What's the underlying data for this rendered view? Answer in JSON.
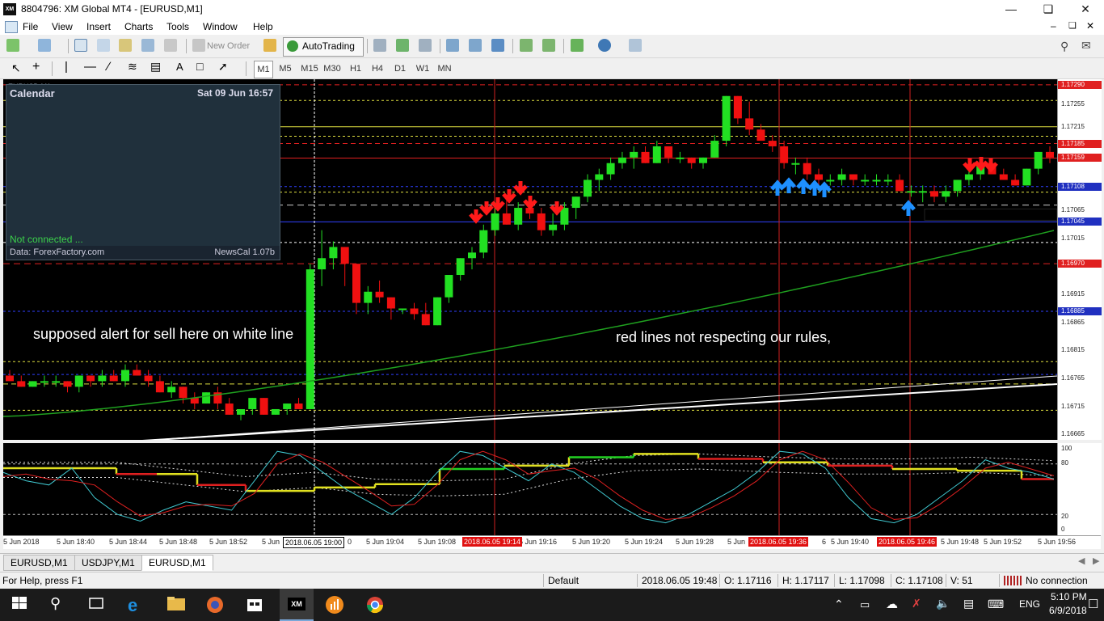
{
  "window": {
    "title": "8804796: XM Global MT4 - [EURUSD,M1]",
    "app_icon_text": "XM"
  },
  "menu": [
    "File",
    "View",
    "Insert",
    "Charts",
    "Tools",
    "Window",
    "Help"
  ],
  "toolbar": {
    "new_order": "New Order",
    "autotrading": "AutoTrading"
  },
  "timeframes": [
    "M1",
    "M5",
    "M15",
    "M30",
    "H1",
    "H4",
    "D1",
    "W1",
    "MN"
  ],
  "chart": {
    "symbol_label": "EURUSD,M1",
    "price_labels": [
      "1.17255",
      "1.17215",
      "1.17065",
      "1.17015",
      "1.16915",
      "1.16865",
      "1.16815",
      "1.16765",
      "1.16715",
      "1.16665"
    ],
    "price_boxes": [
      {
        "text": "1.17290",
        "color": "#e02020"
      },
      {
        "text": "1.17185",
        "color": "#e02020"
      },
      {
        "text": "1.17159",
        "color": "#e02020"
      },
      {
        "text": "1.17108",
        "color": "#2030c0"
      },
      {
        "text": "1.17045",
        "color": "#2030c0"
      },
      {
        "text": "1.16970",
        "color": "#e02020"
      },
      {
        "text": "1.16885",
        "color": "#2030c0"
      }
    ],
    "annotation_left": "supposed alert for sell here on white line",
    "annotation_right": "red lines not respecting our rules,",
    "candles": [
      [
        1.1677,
        1.1678,
        1.1676,
        1.1676
      ],
      [
        1.1676,
        1.1677,
        1.1675,
        1.1675
      ],
      [
        1.1675,
        1.1676,
        1.1675,
        1.1676
      ],
      [
        1.1676,
        1.1677,
        1.1675,
        1.1676
      ],
      [
        1.1676,
        1.1677,
        1.1675,
        1.1676
      ],
      [
        1.1676,
        1.1676,
        1.1674,
        1.1675
      ],
      [
        1.1675,
        1.1677,
        1.1674,
        1.1677
      ],
      [
        1.1677,
        1.1677,
        1.1675,
        1.1676
      ],
      [
        1.1676,
        1.1678,
        1.1675,
        1.1677
      ],
      [
        1.1677,
        1.1678,
        1.1676,
        1.1676
      ],
      [
        1.1676,
        1.1679,
        1.1675,
        1.1678
      ],
      [
        1.1678,
        1.1679,
        1.1677,
        1.1677
      ],
      [
        1.1677,
        1.1678,
        1.1675,
        1.1676
      ],
      [
        1.1676,
        1.1677,
        1.1674,
        1.1674
      ],
      [
        1.1674,
        1.1676,
        1.1673,
        1.1675
      ],
      [
        1.1675,
        1.1675,
        1.1672,
        1.1673
      ],
      [
        1.1673,
        1.1674,
        1.1671,
        1.1672
      ],
      [
        1.1672,
        1.1674,
        1.1672,
        1.1674
      ],
      [
        1.1674,
        1.1675,
        1.1671,
        1.1672
      ],
      [
        1.1672,
        1.1673,
        1.167,
        1.167
      ],
      [
        1.167,
        1.1671,
        1.1669,
        1.1671
      ],
      [
        1.1671,
        1.1673,
        1.167,
        1.1673
      ],
      [
        1.1673,
        1.1673,
        1.167,
        1.167
      ],
      [
        1.167,
        1.1671,
        1.167,
        1.1671
      ],
      [
        1.1671,
        1.1672,
        1.167,
        1.1672
      ],
      [
        1.1672,
        1.1673,
        1.1671,
        1.1671
      ],
      [
        1.1671,
        1.1697,
        1.1671,
        1.1696
      ],
      [
        1.1696,
        1.1703,
        1.1693,
        1.1698
      ],
      [
        1.1698,
        1.1701,
        1.1696,
        1.17
      ],
      [
        1.17,
        1.17,
        1.1693,
        1.1697
      ],
      [
        1.1697,
        1.1697,
        1.1688,
        1.169
      ],
      [
        1.169,
        1.1693,
        1.1688,
        1.1692
      ],
      [
        1.1692,
        1.1694,
        1.169,
        1.1691
      ],
      [
        1.1691,
        1.1691,
        1.1687,
        1.1689
      ],
      [
        1.1689,
        1.1689,
        1.1688,
        1.1689
      ],
      [
        1.1689,
        1.169,
        1.1687,
        1.1688
      ],
      [
        1.1688,
        1.169,
        1.1686,
        1.1686
      ],
      [
        1.1686,
        1.1691,
        1.1686,
        1.1691
      ],
      [
        1.1691,
        1.1695,
        1.169,
        1.1695
      ],
      [
        1.1695,
        1.1698,
        1.1694,
        1.1698
      ],
      [
        1.1698,
        1.17,
        1.1696,
        1.1699
      ],
      [
        1.1699,
        1.1704,
        1.1698,
        1.1703
      ],
      [
        1.1703,
        1.1708,
        1.1702,
        1.1706
      ],
      [
        1.1706,
        1.1709,
        1.1704,
        1.1704
      ],
      [
        1.1704,
        1.1708,
        1.1703,
        1.1707
      ],
      [
        1.1707,
        1.1709,
        1.1705,
        1.1706
      ],
      [
        1.1706,
        1.1707,
        1.1702,
        1.1703
      ],
      [
        1.1703,
        1.1706,
        1.1702,
        1.1704
      ],
      [
        1.1704,
        1.1708,
        1.1703,
        1.1707
      ],
      [
        1.1707,
        1.1709,
        1.1705,
        1.1709
      ],
      [
        1.1709,
        1.1713,
        1.1708,
        1.1712
      ],
      [
        1.1712,
        1.1714,
        1.171,
        1.1713
      ],
      [
        1.1713,
        1.1716,
        1.1712,
        1.1715
      ],
      [
        1.1715,
        1.1717,
        1.1714,
        1.1716
      ],
      [
        1.1716,
        1.1718,
        1.1714,
        1.1717
      ],
      [
        1.1717,
        1.1718,
        1.1715,
        1.1715
      ],
      [
        1.1715,
        1.1719,
        1.1715,
        1.1718
      ],
      [
        1.1718,
        1.1718,
        1.1715,
        1.1716
      ],
      [
        1.1716,
        1.1717,
        1.1715,
        1.1716
      ],
      [
        1.1716,
        1.1716,
        1.1714,
        1.1715
      ],
      [
        1.1715,
        1.1716,
        1.1714,
        1.1716
      ],
      [
        1.1716,
        1.172,
        1.1716,
        1.1719
      ],
      [
        1.1719,
        1.1727,
        1.1718,
        1.1727
      ],
      [
        1.1727,
        1.1727,
        1.1722,
        1.1723
      ],
      [
        1.1723,
        1.1726,
        1.172,
        1.1721
      ],
      [
        1.1721,
        1.1722,
        1.1719,
        1.1719
      ],
      [
        1.1719,
        1.172,
        1.1717,
        1.1718
      ],
      [
        1.1718,
        1.1719,
        1.1714,
        1.1715
      ],
      [
        1.1715,
        1.1716,
        1.1713,
        1.1715
      ],
      [
        1.1715,
        1.1716,
        1.1712,
        1.1713
      ],
      [
        1.1713,
        1.1714,
        1.1711,
        1.1712
      ],
      [
        1.1712,
        1.1713,
        1.1711,
        1.1712
      ],
      [
        1.1712,
        1.1714,
        1.1711,
        1.1713
      ],
      [
        1.1713,
        1.1713,
        1.1711,
        1.1712
      ],
      [
        1.1712,
        1.1713,
        1.1711,
        1.1712
      ],
      [
        1.1712,
        1.1713,
        1.1711,
        1.1712
      ],
      [
        1.1712,
        1.1713,
        1.1711,
        1.1712
      ],
      [
        1.1712,
        1.1713,
        1.171,
        1.171
      ],
      [
        1.171,
        1.1711,
        1.1709,
        1.171
      ],
      [
        1.171,
        1.1711,
        1.1708,
        1.171
      ],
      [
        1.171,
        1.1711,
        1.1708,
        1.1709
      ],
      [
        1.1709,
        1.1711,
        1.1708,
        1.171
      ],
      [
        1.171,
        1.1712,
        1.1709,
        1.1712
      ],
      [
        1.1712,
        1.1714,
        1.1711,
        1.1713
      ],
      [
        1.1713,
        1.1716,
        1.1712,
        1.1715
      ],
      [
        1.1715,
        1.1715,
        1.1713,
        1.1713
      ],
      [
        1.1713,
        1.1714,
        1.1712,
        1.1712
      ],
      [
        1.1712,
        1.1713,
        1.1711,
        1.1711
      ],
      [
        1.1711,
        1.1714,
        1.1711,
        1.1714
      ],
      [
        1.1714,
        1.1717,
        1.1713,
        1.1717
      ],
      [
        1.1717,
        1.1718,
        1.1715,
        1.1716
      ],
      [
        1.1716,
        1.1717,
        1.1714,
        1.1715
      ],
      [
        1.1715,
        1.1718,
        1.1714,
        1.1717
      ]
    ]
  },
  "indicator": {
    "levels": [
      "100",
      "80",
      "20",
      "0"
    ]
  },
  "time_axis": {
    "labels": [
      "5 Jun 2018",
      "5 Jun 18:40",
      "5 Jun 18:44",
      "5 Jun 18:48",
      "5 Jun 18:52",
      "5 Jun",
      "0",
      "5 Jun 19:04",
      "5 Jun 19:08",
      "5 Jun 19:16",
      "5 Jun 19:20",
      "5 Jun 19:24",
      "5 Jun 19:28",
      "5 Jun",
      "6",
      "5 Jun 19:40",
      "5 Jun 19:48",
      "5 Jun 19:52",
      "5 Jun 19:56"
    ],
    "highlighted": [
      {
        "text": "2018.06.05 19:00",
        "style": "white"
      },
      {
        "text": "2018.06.05 19:14",
        "style": "red"
      },
      {
        "text": "2018.06.05 19:36",
        "style": "red"
      },
      {
        "text": "2018.06.05 19:46",
        "style": "red"
      }
    ]
  },
  "calendar": {
    "title": "Calendar",
    "date": "Sat 09 Jun 16:57",
    "status": "Not connected ...",
    "source": "Data: ForexFactory.com",
    "version": "NewsCal 1.07b"
  },
  "tabs": [
    {
      "label": "EURUSD,M1",
      "active": false
    },
    {
      "label": "USDJPY,M1",
      "active": false
    },
    {
      "label": "EURUSD,M1",
      "active": true
    }
  ],
  "statusbar": {
    "help": "For Help, press F1",
    "profile": "Default",
    "datetime": "2018.06.05 19:48",
    "open": "O: 1.17116",
    "high": "H: 1.17117",
    "low": "L: 1.17098",
    "close": "C: 1.17108",
    "volume": "V: 51",
    "connection": "No connection"
  },
  "taskbar": {
    "time": "5:10 PM",
    "date": "6/9/2018",
    "language": "ENG"
  }
}
